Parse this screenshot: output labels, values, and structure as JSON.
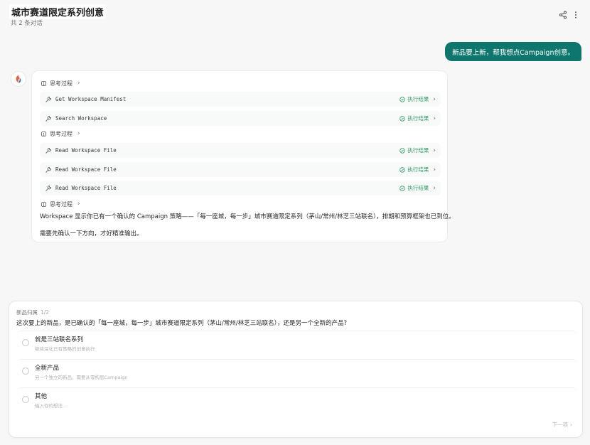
{
  "header": {
    "title": "城市赛道限定系列创意",
    "subtitle": "共 2 条对话",
    "share_icon": "share-icon",
    "more_icon": "more-vertical-icon"
  },
  "user_message": "新品要上新，帮我想点Campaign创意。",
  "assistant": {
    "avatar_icon": "assistant-logo-icon",
    "think_label": "思考过程",
    "result_label": "执行结果",
    "tools_group1": [
      "Get Workspace Manifest",
      "Search Workspace"
    ],
    "tools_group2": [
      "Read Workspace File",
      "Read Workspace File",
      "Read Workspace File"
    ],
    "text1": "Workspace 显示你已有一个确认的 Campaign 策略——「每一座城，每一步」城市赛道限定系列（茅山/常州/林芝三站联名），排期和预算框架也已到位。",
    "text2": "需要先确认一下方向，才好精准输出。"
  },
  "question": {
    "label": "新品归属",
    "count": "1/2",
    "text": "这次要上的新品，是已确认的「每一座城，每一步」城市赛道限定系列（茅山/常州/林芝三站联名），还是另一个全新的产品?",
    "options": [
      {
        "title": "就是三站联名系列",
        "desc": "继续深化已有策略的创意执行"
      },
      {
        "title": "全新产品",
        "desc": "另一个独立的新品，需要从零构思Campaign"
      },
      {
        "title": "其他",
        "desc": "输入你的想法..."
      }
    ],
    "next_label": "下一项"
  },
  "colors": {
    "accent": "#0f766e",
    "success": "#2f9a61",
    "background": "#f7f7f7"
  }
}
